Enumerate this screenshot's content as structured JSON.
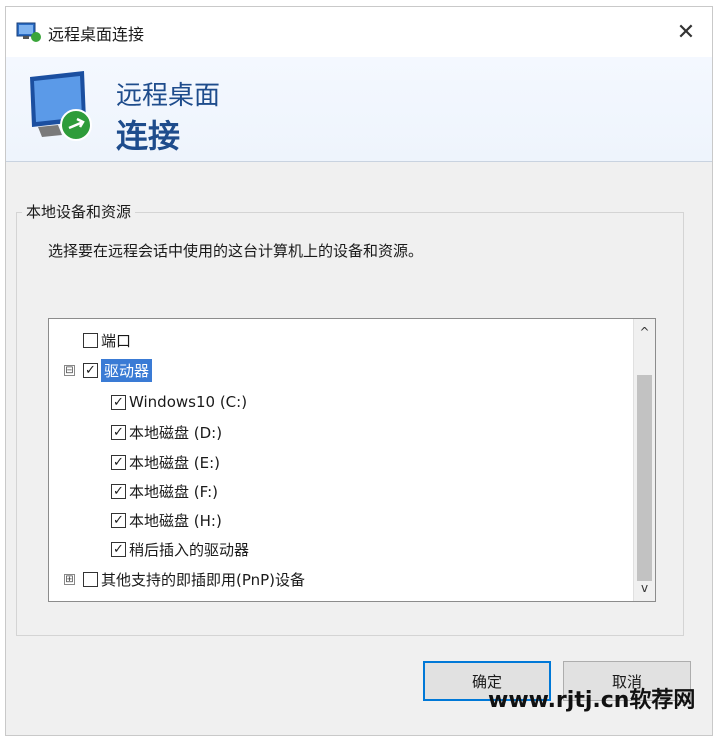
{
  "window": {
    "title": "远程桌面连接",
    "close_glyph": "✕"
  },
  "banner": {
    "line1": "远程桌面",
    "line2": "连接"
  },
  "group": {
    "legend": "本地设备和资源",
    "description": "选择要在远程会话中使用的这台计算机上的设备和资源。"
  },
  "tree": {
    "items": [
      {
        "label": "端口",
        "checked": false
      },
      {
        "label": "驱动器",
        "checked": true,
        "expander": "⊟",
        "selected": true
      },
      {
        "label": "Windows10 (C:)",
        "checked": true
      },
      {
        "label": "本地磁盘 (D:)",
        "checked": true
      },
      {
        "label": "本地磁盘 (E:)",
        "checked": true
      },
      {
        "label": "本地磁盘 (F:)",
        "checked": true
      },
      {
        "label": "本地磁盘 (H:)",
        "checked": true
      },
      {
        "label": "稍后插入的驱动器",
        "checked": true
      },
      {
        "label": "其他支持的即插即用(PnP)设备",
        "checked": false,
        "expander": "⊞"
      }
    ],
    "scroll_up": "^",
    "scroll_down": "v",
    "check_glyph": "✓"
  },
  "buttons": {
    "ok": "确定",
    "cancel": "取消"
  },
  "watermark": "www.rjtj.cn软荐网",
  "colors": {
    "accent": "#0078d7",
    "banner_text": "#1e4c8c",
    "selection": "#3a7bd5"
  }
}
